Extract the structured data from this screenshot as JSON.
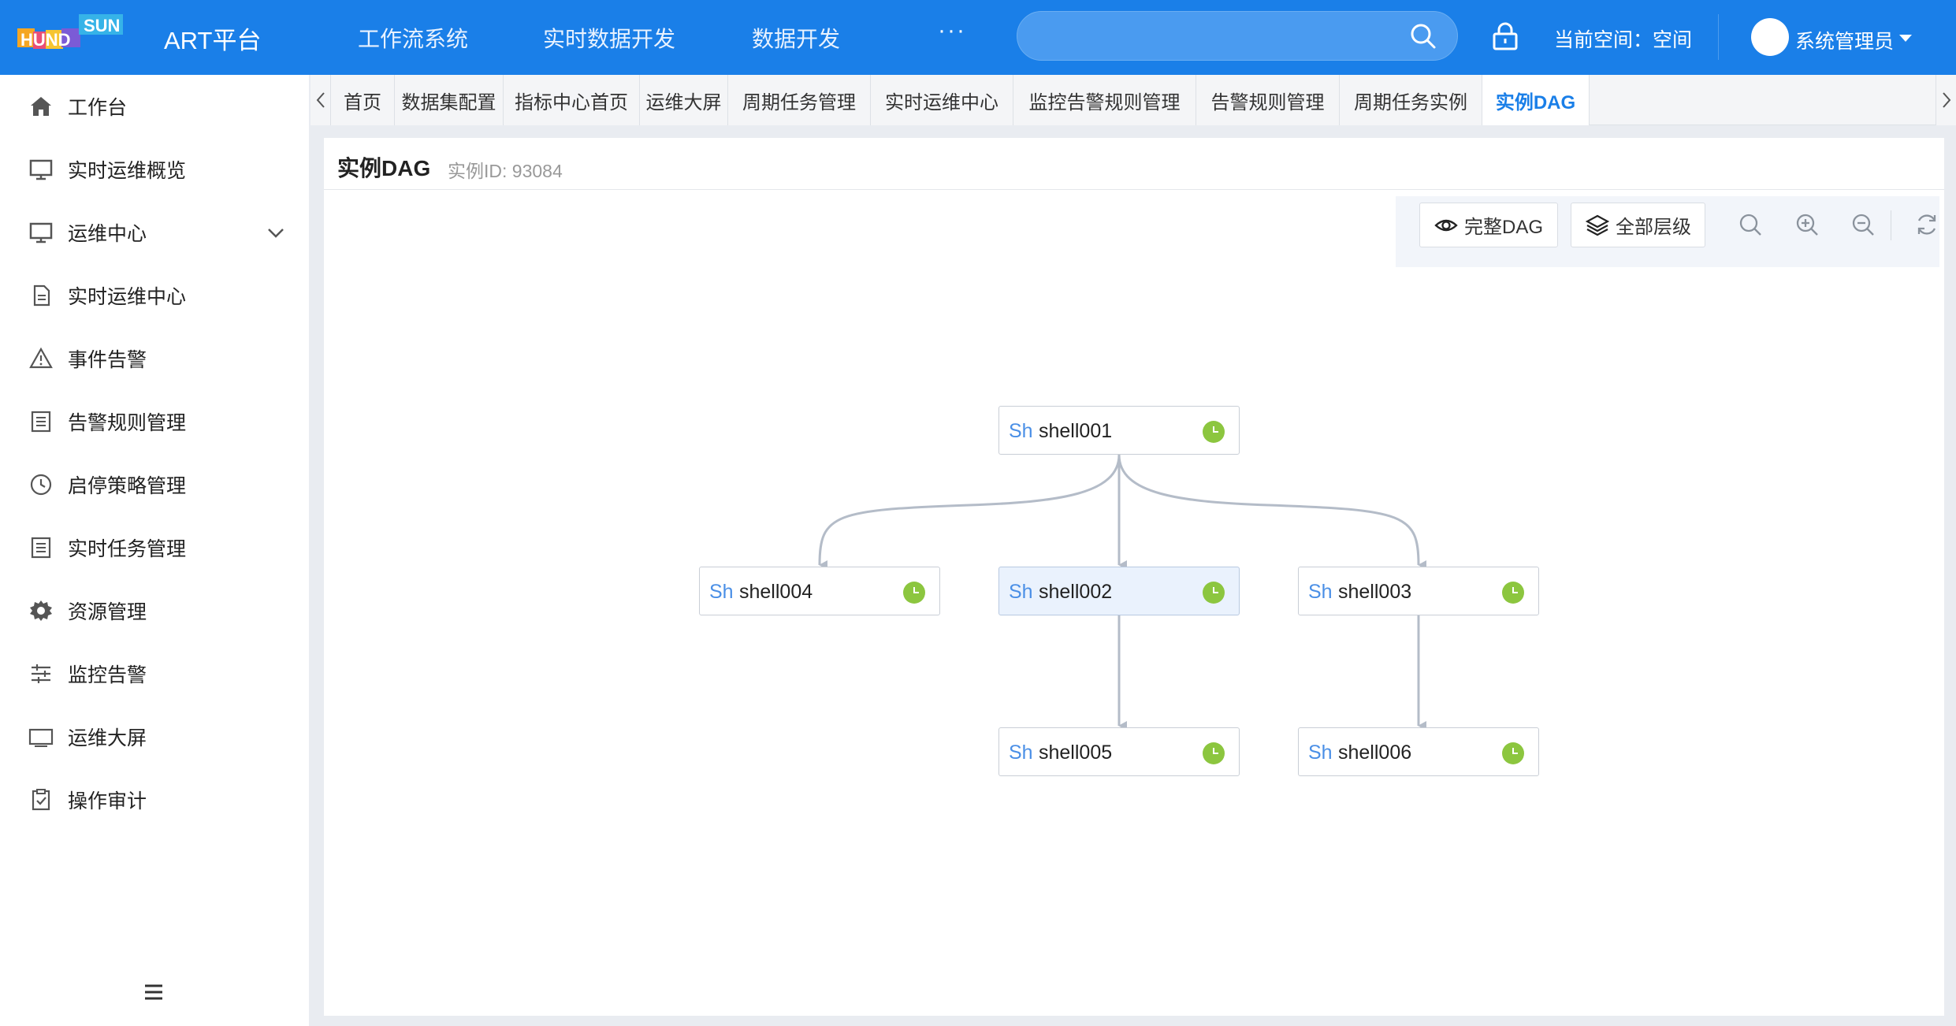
{
  "header": {
    "logo_text": "HUNDSUN",
    "app_title": "ART平台",
    "nav": [
      "工作流系统",
      "实时数据开发",
      "数据开发"
    ],
    "more": "···",
    "search": {
      "placeholder": "",
      "value": ""
    },
    "space_label": "当前空间：空间",
    "user_name": "系统管理员"
  },
  "sidebar": {
    "items": [
      {
        "label": "工作台",
        "icon": "home-icon"
      },
      {
        "label": "实时运维概览",
        "icon": "monitor-icon"
      },
      {
        "label": "运维中心",
        "icon": "monitor-icon",
        "expanded": true
      },
      {
        "label": "实时运维中心",
        "icon": "document-icon"
      },
      {
        "label": "事件告警",
        "icon": "warning-icon"
      },
      {
        "label": "告警规则管理",
        "icon": "list-icon"
      },
      {
        "label": "启停策略管理",
        "icon": "clock-icon"
      },
      {
        "label": "实时任务管理",
        "icon": "list-icon"
      },
      {
        "label": "资源管理",
        "icon": "gear-icon"
      },
      {
        "label": "监控告警",
        "icon": "sliders-icon"
      },
      {
        "label": "运维大屏",
        "icon": "screen-icon"
      },
      {
        "label": "操作审计",
        "icon": "clipboard-check-icon"
      }
    ]
  },
  "tabs": {
    "items": [
      "首页",
      "数据集配置",
      "指标中心首页",
      "运维大屏",
      "周期任务管理",
      "实时运维中心",
      "监控告警规则管理",
      "告警规则管理",
      "周期任务实例",
      "实例DAG"
    ],
    "active": "实例DAG"
  },
  "panel": {
    "title": "实例DAG",
    "subtitle": "实例ID: 93084"
  },
  "toolbar": {
    "full_dag": "完整DAG",
    "all_levels": "全部层级"
  },
  "dag": {
    "nodes": [
      {
        "id": "shell001",
        "tag": "Sh",
        "name": "shell001",
        "status": "waiting",
        "selected": false
      },
      {
        "id": "shell004",
        "tag": "Sh",
        "name": "shell004",
        "status": "waiting",
        "selected": false
      },
      {
        "id": "shell002",
        "tag": "Sh",
        "name": "shell002",
        "status": "waiting",
        "selected": true
      },
      {
        "id": "shell003",
        "tag": "Sh",
        "name": "shell003",
        "status": "waiting",
        "selected": false
      },
      {
        "id": "shell005",
        "tag": "Sh",
        "name": "shell005",
        "status": "waiting",
        "selected": false
      },
      {
        "id": "shell006",
        "tag": "Sh",
        "name": "shell006",
        "status": "waiting",
        "selected": false
      }
    ],
    "edges": [
      [
        "shell001",
        "shell004"
      ],
      [
        "shell001",
        "shell002"
      ],
      [
        "shell001",
        "shell003"
      ],
      [
        "shell002",
        "shell005"
      ],
      [
        "shell003",
        "shell006"
      ]
    ]
  },
  "colors": {
    "primary": "#1a7fe8",
    "status_waiting": "#8cc63f",
    "edge": "#b4bcc8",
    "selected_node": "#eaf2fd"
  }
}
